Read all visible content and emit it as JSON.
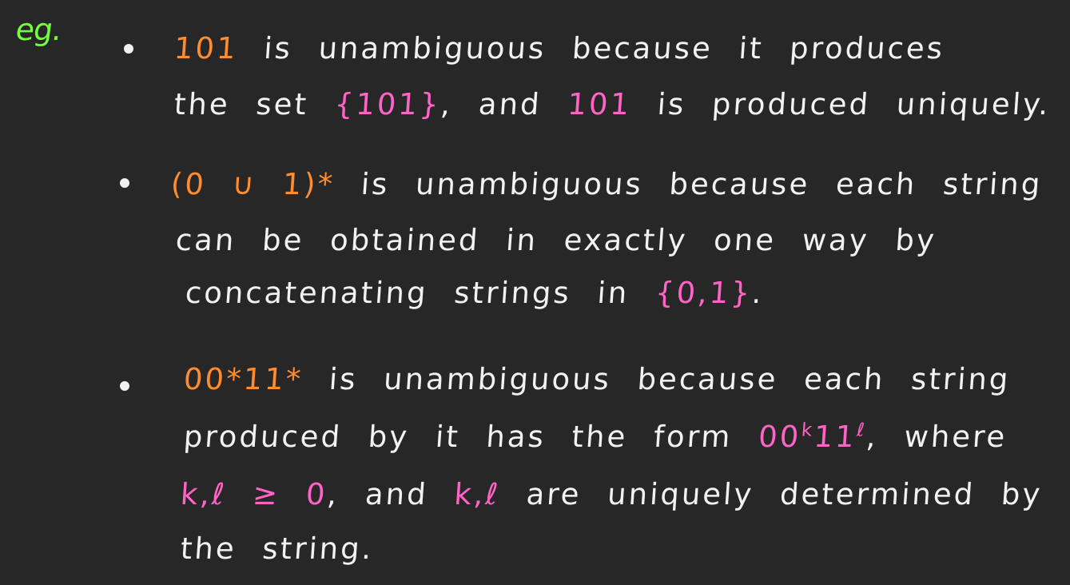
{
  "note": {
    "prefix": "eg.",
    "bullets": [
      {
        "lines": [
          [
            "101",
            " is unambiguous because it produces"
          ],
          [
            "the set ",
            "{101}",
            ", and ",
            "101",
            " is produced uniquely."
          ]
        ]
      },
      {
        "lines": [
          [
            "(0 ∪ 1)*",
            " is unambiguous because each string"
          ],
          [
            "can be obtained in exactly one way by"
          ],
          [
            "concatenating strings in ",
            "{0,1}",
            "."
          ]
        ]
      },
      {
        "lines": [
          [
            "00*11*",
            " is unambiguous because each string"
          ],
          [
            "produced by it has the form ",
            "00",
            "k",
            "11",
            "ℓ",
            ", where"
          ],
          [
            "k,ℓ ≥ 0",
            ", and ",
            "k,ℓ",
            " are uniquely determined by"
          ],
          [
            "the string."
          ]
        ]
      }
    ]
  },
  "colors": {
    "background": "#272727",
    "green": "#74ff3e",
    "orange": "#ff8c2f",
    "pink": "#ff63c6",
    "white": "#f2f2f2"
  }
}
